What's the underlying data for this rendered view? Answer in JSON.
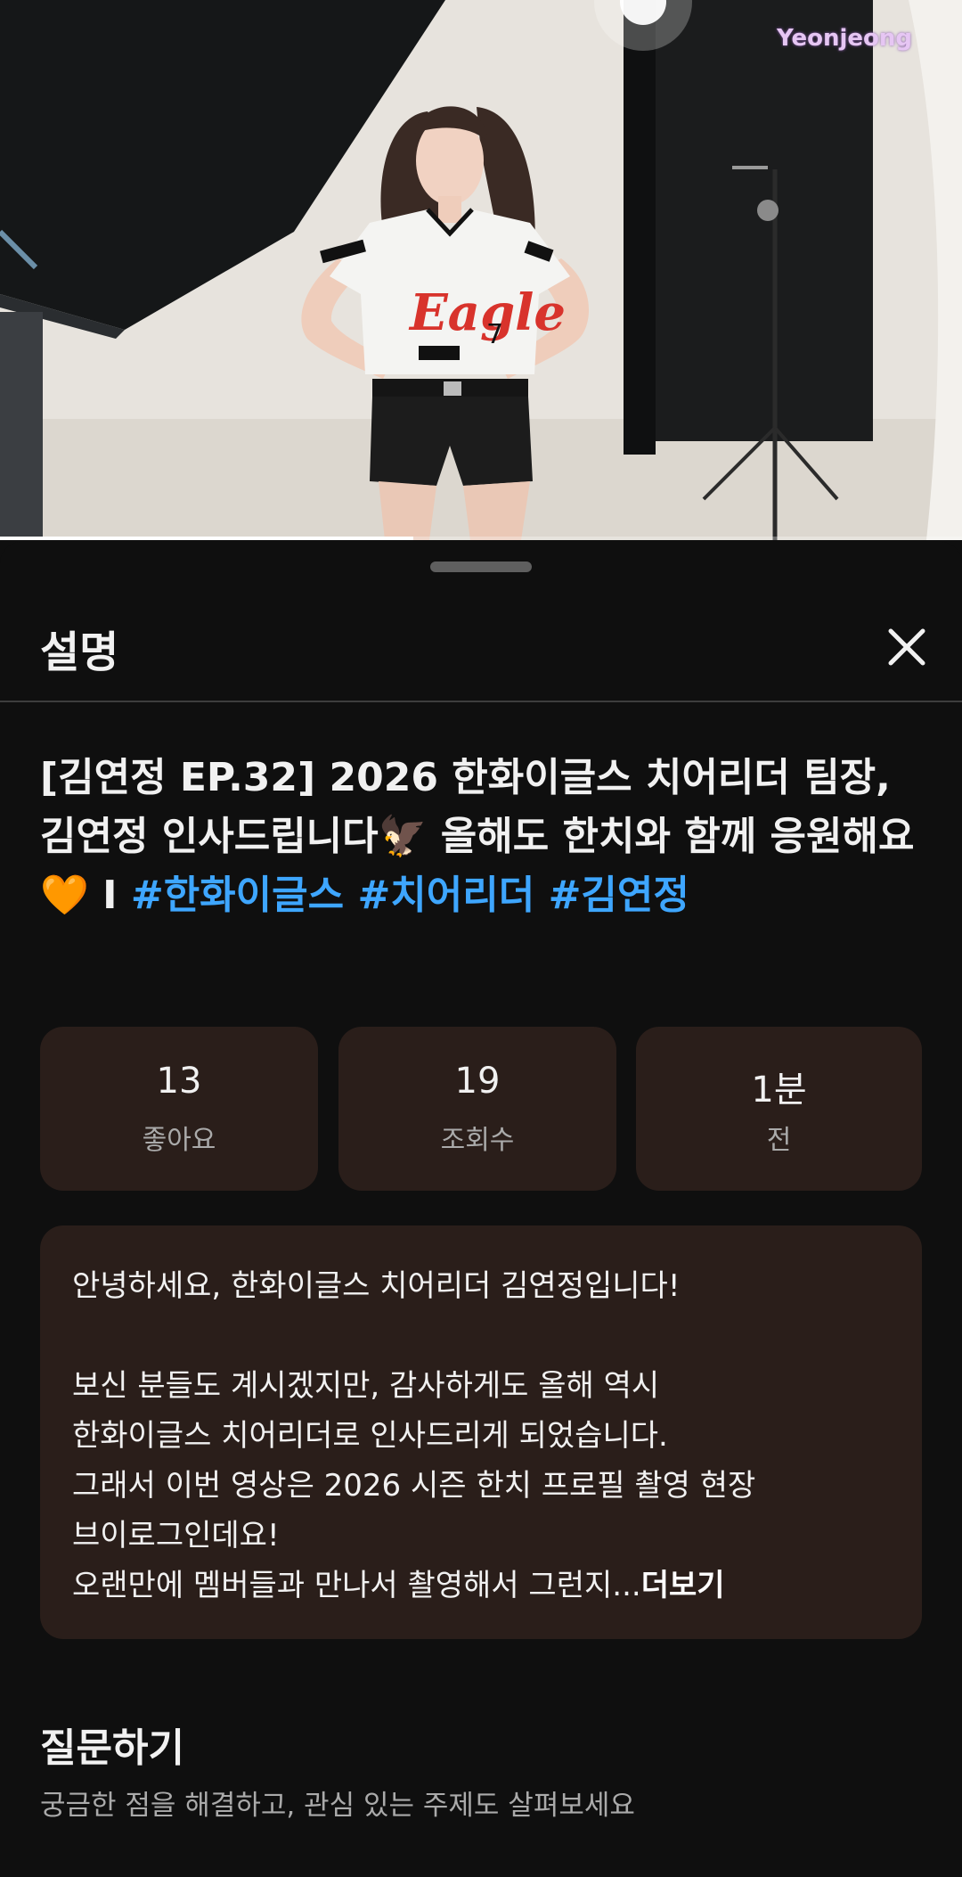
{
  "video": {
    "watermark": "Yeonjeong",
    "progress_fraction": 0.43
  },
  "sheet": {
    "title": "설명",
    "close_icon": "close-icon"
  },
  "video_title": {
    "prefix": "[김연정 EP.32] 2026 한화이글스 치어리더 팀장, 김연정 인사드립니다",
    "eagle_emoji": "🦅",
    "middle": " 올해도 한치와 함께 응원해요",
    "heart_emoji": "🧡",
    "separator": "  I",
    "hashtags": [
      "#한화이글스",
      "#치어리더",
      "#김연정"
    ]
  },
  "stats": [
    {
      "value": "13",
      "label": "좋아요"
    },
    {
      "value": "19",
      "label": "조회수"
    },
    {
      "value": "1분",
      "label": "전"
    }
  ],
  "description": {
    "lines": [
      "안녕하세요, 한화이글스 치어리더 김연정입니다!",
      "",
      "보신 분들도 계시겠지만, 감사하게도 올해 역시",
      "한화이글스 치어리더로 인사드리게 되었습니다.",
      "그래서 이번 영상은 2026 시즌 한치 프로필 촬영 현장",
      "브이로그인데요!",
      "오랜만에 멤버들과 만나서 촬영해서 그런지..."
    ],
    "more_label": "더보기"
  },
  "ask": {
    "title": "질문하기",
    "subtitle": "궁금한 점을 해결하고, 관심 있는 주제도 살펴보세요"
  }
}
